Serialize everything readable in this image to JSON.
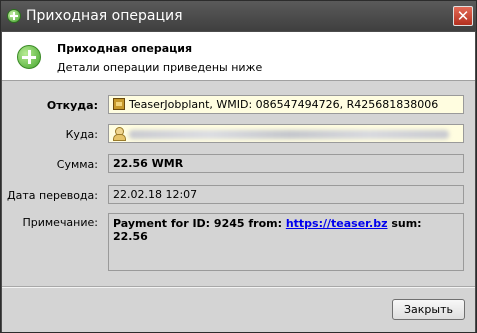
{
  "window": {
    "title": "Приходная операция",
    "close_glyph": "✕"
  },
  "header": {
    "title": "Приходная операция",
    "subtitle": "Детали операции приведены ниже",
    "icon": "add-circle-icon"
  },
  "form": {
    "from_label": "Откуда:",
    "from_value": "TeaserJobplant, WMID: 086547494726, R425681838006",
    "to_label": "Куда:",
    "to_value": "",
    "amount_label": "Сумма:",
    "amount_value": "22.56 WMR",
    "date_label": "Дата перевода:",
    "date_value": "22.02.18 12:07",
    "note_label": "Примечание:",
    "note_prefix": "Payment for ID: 9245 from: ",
    "note_link": "https://teaser.bz",
    "note_suffix": " sum: 22.56"
  },
  "footer": {
    "close_label": "Закрыть"
  },
  "colors": {
    "titlebar": "#4d4d4d",
    "close_button": "#c9402c",
    "field_highlight": "#fffde0",
    "link": "#0000ee"
  }
}
